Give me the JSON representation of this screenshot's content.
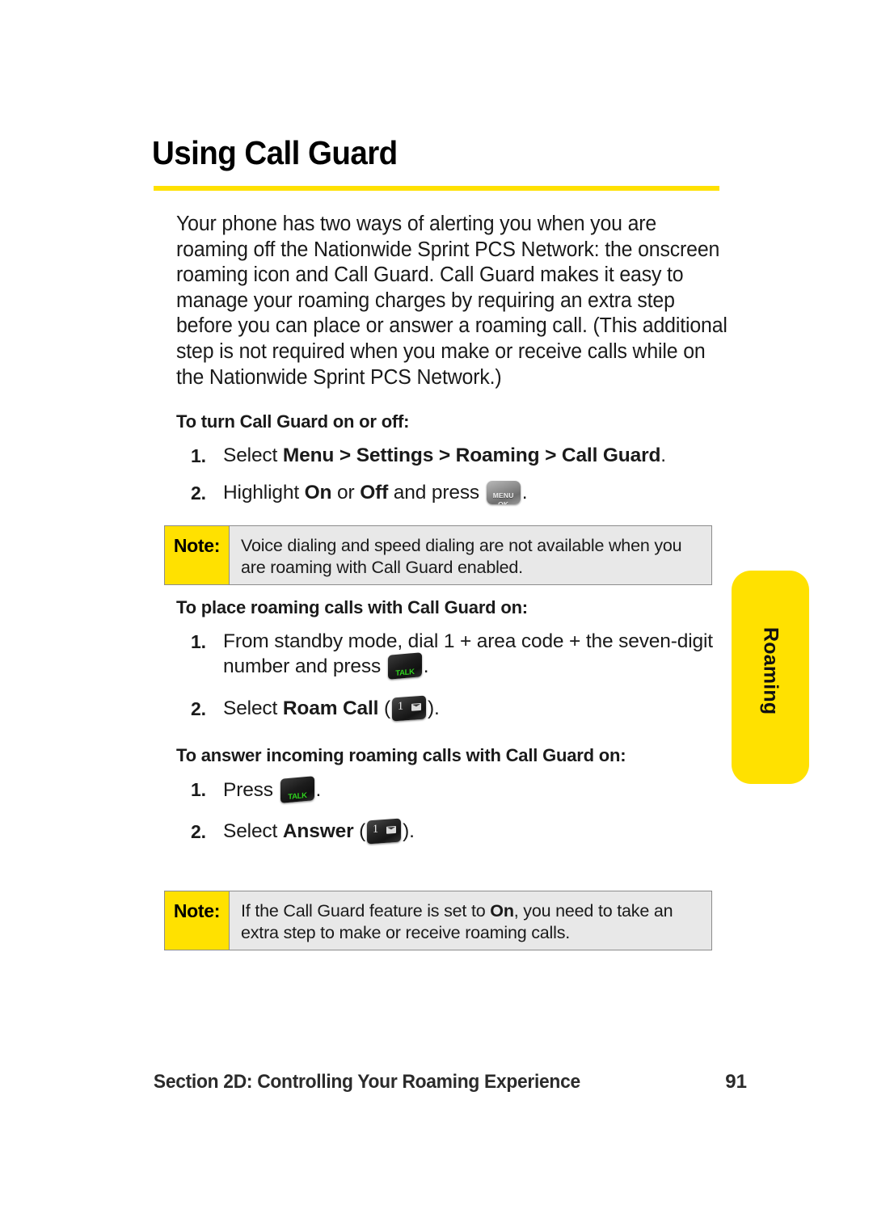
{
  "page": {
    "title": "Using Call Guard",
    "side_tab_label": "Roaming",
    "accent_yellow": "#ffe100",
    "rule_color": "#ffe100"
  },
  "intro": {
    "paragraph": "Your phone has two ways of alerting you when you are roaming off the Nationwide Sprint PCS Network: the onscreen roaming icon and Call Guard. Call Guard makes it easy to manage your roaming charges by requiring an extra step before you can place or answer a roaming call. (This additional step is not required when you make or receive calls while on the Nationwide Sprint PCS Network.)"
  },
  "sections": [
    {
      "heading": "To turn Call Guard on or off:",
      "steps": [
        {
          "number": "1.",
          "prefix": "Select ",
          "bold1": "Menu",
          "sep1": " > ",
          "bold2": "Settings",
          "sep2": " > ",
          "bold3": "Roaming",
          "sep3": " > ",
          "bold4": "Call Guard",
          "suffix": "."
        },
        {
          "number": "2.",
          "prefix": "Highlight ",
          "bold1": "On",
          "sep1": " or ",
          "bold2": "Off",
          "sep2": " and press ",
          "suffix": "."
        }
      ]
    },
    {
      "heading": "To place roaming calls with Call Guard on:",
      "steps": [
        {
          "number": "1.",
          "prefix": "From standby mode, dial 1 + area code + the seven-digit number and press ",
          "suffix": "."
        },
        {
          "number": "2.",
          "prefix": "Select ",
          "bold1": "Roam Call",
          "sep1": " (",
          "suffix": ")."
        }
      ]
    },
    {
      "heading": "To answer incoming roaming calls with Call Guard on:",
      "steps": [
        {
          "number": "1.",
          "prefix": "Press ",
          "suffix": "."
        },
        {
          "number": "2.",
          "prefix": "Select ",
          "bold1": "Answer",
          "sep1": " (",
          "suffix": ")."
        }
      ]
    }
  ],
  "notes": [
    {
      "label": "Note:",
      "text_a": "Voice dialing and speed dialing are not available when you are roaming with Call Guard enabled.",
      "bold": "",
      "text_b": ""
    },
    {
      "label": "Note:",
      "text_a": "If the Call Guard feature is set to ",
      "bold": "On",
      "text_b": ", you need to take an extra step to make or receive roaming calls."
    }
  ],
  "keys": {
    "menu_line1": "MENU",
    "menu_line2": "OK",
    "talk_label": "TALK",
    "one_digit": "1"
  },
  "footer": {
    "section": "Section 2D: Controlling Your Roaming Experience",
    "page_number": "91"
  }
}
